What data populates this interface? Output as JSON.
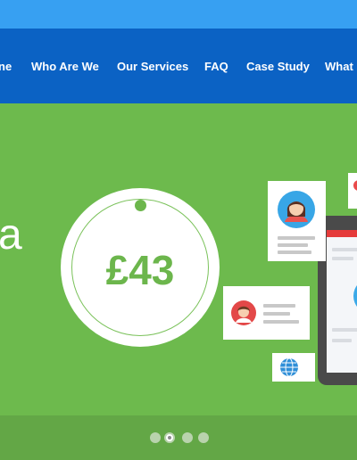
{
  "nav": {
    "items": [
      {
        "label": "ne"
      },
      {
        "label": "Who Are We"
      },
      {
        "label": "Our Services"
      },
      {
        "label": "FAQ"
      },
      {
        "label": "Case Study"
      },
      {
        "label": "What"
      }
    ]
  },
  "hero": {
    "headline_fragment": "a",
    "price": "£43",
    "slider": {
      "total": 4,
      "active_index": 1
    }
  },
  "colors": {
    "top_bar": "#37a0f2",
    "nav_bar": "#0b62c4",
    "hero_bg": "#6dba4d",
    "accent_green": "#6cb64c"
  },
  "icons": [
    "user-avatar-icon",
    "user-avatar-female-icon",
    "globe-icon",
    "price-tag-icon",
    "tablet-icon"
  ]
}
